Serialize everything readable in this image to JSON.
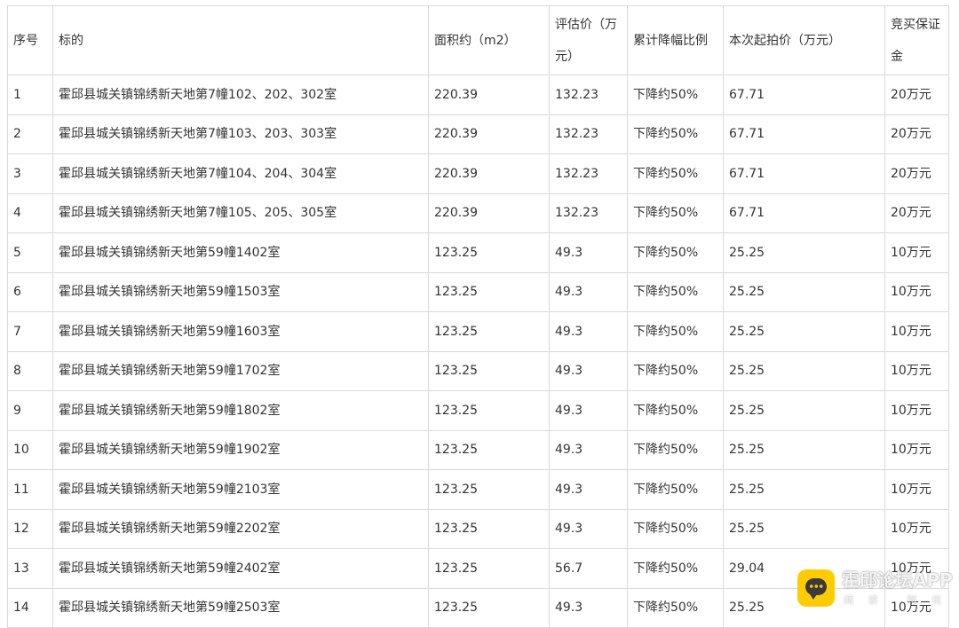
{
  "table": {
    "headers": {
      "seq": "序号",
      "subject": "标的",
      "area": "面积约（m2）",
      "valuation": "评估价（万元）",
      "reduction": "累计降幅比例",
      "start_price": "本次起拍价（万元）",
      "deposit": "竞买保证金"
    },
    "rows": [
      {
        "seq": "1",
        "subject": "霍邱县城关镇锦绣新天地第7幢102、202、302室",
        "area": "220.39",
        "valuation": "132.23",
        "reduction": "下降约50%",
        "start_price": "67.71",
        "deposit": "20万元"
      },
      {
        "seq": "2",
        "subject": "霍邱县城关镇锦绣新天地第7幢103、203、303室",
        "area": "220.39",
        "valuation": "132.23",
        "reduction": "下降约50%",
        "start_price": "67.71",
        "deposit": "20万元"
      },
      {
        "seq": "3",
        "subject": "霍邱县城关镇锦绣新天地第7幢104、204、304室",
        "area": "220.39",
        "valuation": "132.23",
        "reduction": "下降约50%",
        "start_price": "67.71",
        "deposit": "20万元"
      },
      {
        "seq": "4",
        "subject": "霍邱县城关镇锦绣新天地第7幢105、205、305室",
        "area": "220.39",
        "valuation": "132.23",
        "reduction": "下降约50%",
        "start_price": "67.71",
        "deposit": "20万元"
      },
      {
        "seq": "5",
        "subject": "霍邱县城关镇锦绣新天地第59幢1402室",
        "area": "123.25",
        "valuation": "49.3",
        "reduction": "下降约50%",
        "start_price": "25.25",
        "deposit": "10万元"
      },
      {
        "seq": "6",
        "subject": "霍邱县城关镇锦绣新天地第59幢1503室",
        "area": "123.25",
        "valuation": "49.3",
        "reduction": "下降约50%",
        "start_price": "25.25",
        "deposit": "10万元"
      },
      {
        "seq": "7",
        "subject": "霍邱县城关镇锦绣新天地第59幢1603室",
        "area": "123.25",
        "valuation": "49.3",
        "reduction": "下降约50%",
        "start_price": "25.25",
        "deposit": "10万元"
      },
      {
        "seq": "8",
        "subject": "霍邱县城关镇锦绣新天地第59幢1702室",
        "area": "123.25",
        "valuation": "49.3",
        "reduction": "下降约50%",
        "start_price": "25.25",
        "deposit": "10万元"
      },
      {
        "seq": "9",
        "subject": "霍邱县城关镇锦绣新天地第59幢1802室",
        "area": "123.25",
        "valuation": "49.3",
        "reduction": "下降约50%",
        "start_price": "25.25",
        "deposit": "10万元"
      },
      {
        "seq": "10",
        "subject": "霍邱县城关镇锦绣新天地第59幢1902室",
        "area": "123.25",
        "valuation": "49.3",
        "reduction": "下降约50%",
        "start_price": "25.25",
        "deposit": "10万元"
      },
      {
        "seq": "11",
        "subject": "霍邱县城关镇锦绣新天地第59幢2103室",
        "area": "123.25",
        "valuation": "49.3",
        "reduction": "下降约50%",
        "start_price": "25.25",
        "deposit": "10万元"
      },
      {
        "seq": "12",
        "subject": "霍邱县城关镇锦绣新天地第59幢2202室",
        "area": "123.25",
        "valuation": "49.3",
        "reduction": "下降约50%",
        "start_price": "25.25",
        "deposit": "10万元"
      },
      {
        "seq": "13",
        "subject": "霍邱县城关镇锦绣新天地第59幢2402室",
        "area": "123.25",
        "valuation": "56.7",
        "reduction": "下降约50%",
        "start_price": "29.04",
        "deposit": "10万元"
      },
      {
        "seq": "14",
        "subject": "霍邱县城关镇锦绣新天地第59幢2503室",
        "area": "123.25",
        "valuation": "49.3",
        "reduction": "下降约50%",
        "start_price": "25.25",
        "deposit": "10万元"
      }
    ]
  },
  "watermark": {
    "title": "霍邱论坛APP",
    "sub_chars": [
      "阅",
      "读",
      "",
      "网",
      "讯"
    ],
    "icon": "chat-bubble-icon",
    "icon_color": "#ffcc00"
  }
}
